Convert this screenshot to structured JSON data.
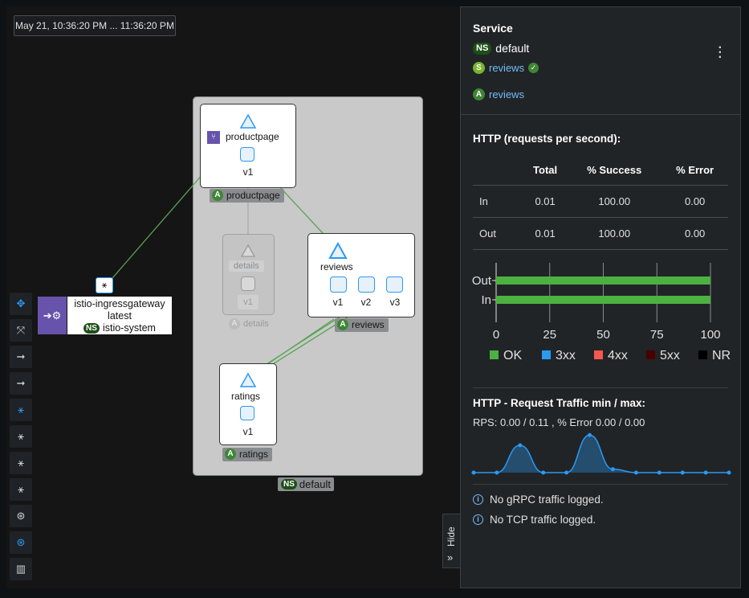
{
  "time_range": "May 21, 10:36:20 PM ... 11:36:20 PM",
  "graph": {
    "namespace_label": "default",
    "ingress": {
      "name": "istio-ingressgateway",
      "version": "latest",
      "namespace": "istio-system"
    },
    "nodes": {
      "productpage": {
        "service": "productpage",
        "version": "v1",
        "app": "productpage"
      },
      "details": {
        "service": "details",
        "version": "v1",
        "app": "details"
      },
      "reviews": {
        "service": "reviews",
        "versions": [
          "v1",
          "v2",
          "v3"
        ],
        "app": "reviews"
      },
      "ratings": {
        "service": "ratings",
        "version": "v1",
        "app": "ratings"
      }
    },
    "badges": {
      "ns": "NS",
      "app": "A"
    }
  },
  "toolbar": {
    "icons": [
      "move-icon",
      "fit-icon",
      "arrow-icon",
      "arrow-icon",
      "layout-icon",
      "layout-icon",
      "layout-icon",
      "layout-icon",
      "layout-icon",
      "layout-icon",
      "map-icon"
    ]
  },
  "side_panel": {
    "title": "Service",
    "namespace_badge": "NS",
    "namespace": "default",
    "service_badge": "S",
    "service_link": "reviews",
    "app_badge": "A",
    "app_link": "reviews",
    "http_heading": "HTTP (requests per second):",
    "table": {
      "headers": [
        "",
        "Total",
        "% Success",
        "% Error"
      ],
      "rows": [
        [
          "In",
          "0.01",
          "100.00",
          "0.00"
        ],
        [
          "Out",
          "0.01",
          "100.00",
          "0.00"
        ]
      ]
    },
    "traffic_heading": "HTTP - Request Traffic min / max:",
    "rps_text": "RPS: 0.00 / 0.11 , % Error 0.00 / 0.00",
    "no_grpc": "No gRPC traffic logged.",
    "no_tcp": "No TCP traffic logged.",
    "hide_label": "Hide"
  },
  "chart_data": [
    {
      "type": "bar",
      "categories": [
        "Out",
        "In"
      ],
      "series": [
        {
          "name": "OK",
          "values": [
            100,
            100
          ],
          "color": "#4cb140"
        },
        {
          "name": "3xx",
          "values": [
            0,
            0
          ],
          "color": "#2b9af3"
        },
        {
          "name": "4xx",
          "values": [
            0,
            0
          ],
          "color": "#f4584e"
        },
        {
          "name": "5xx",
          "values": [
            0,
            0
          ],
          "color": "#470000"
        },
        {
          "name": "NR",
          "values": [
            0,
            0
          ],
          "color": "#000000"
        }
      ],
      "xticks": [
        0,
        25,
        50,
        75,
        100
      ],
      "xlim": [
        0,
        100
      ]
    },
    {
      "type": "area",
      "values": [
        0,
        0,
        0.08,
        0,
        0,
        0.11,
        0.01,
        0,
        0,
        0,
        0,
        0
      ],
      "ylim": [
        0,
        0.12
      ],
      "color": "#2b9af3"
    }
  ]
}
